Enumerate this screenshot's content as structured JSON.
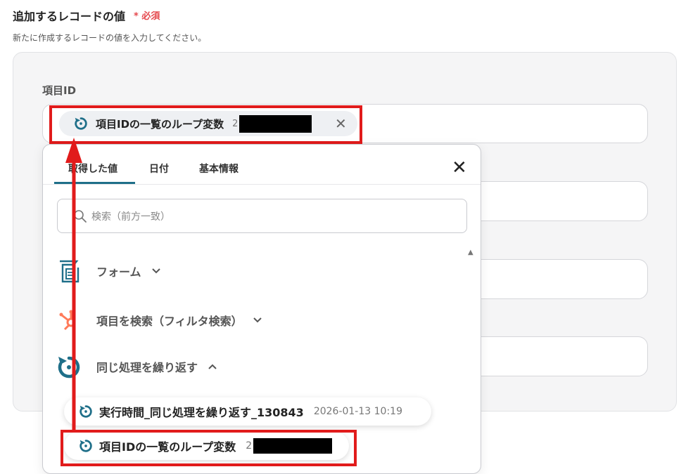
{
  "section": {
    "title": "追加するレコードの値",
    "required_mark": "* 必須",
    "description": "新たに作成するレコードの値を入力してください。"
  },
  "field": {
    "label": "項目ID",
    "chip_label": "項目IDの一覧のループ変数",
    "chip_value_prefix": "2"
  },
  "dropdown": {
    "tabs": [
      {
        "label": "取得した値"
      },
      {
        "label": "日付"
      },
      {
        "label": "基本情報"
      }
    ],
    "search_placeholder": "検索（前方一致）",
    "groups": [
      {
        "label": "フォーム",
        "icon": "form-icon"
      },
      {
        "label": "項目を検索（フィルタ検索）",
        "icon": "hubspot-icon"
      },
      {
        "label": "同じ処理を繰り返す",
        "icon": "loop-icon"
      }
    ],
    "items": [
      {
        "label": "実行時間_同じ処理を繰り返す_130843",
        "value": "2026-01-13 10:19"
      },
      {
        "label": "項目IDの一覧のループ変数",
        "value": "2"
      }
    ]
  },
  "colors": {
    "accent": "#1f6f89",
    "required": "#e5484d",
    "highlight": "#e11b1b",
    "hubspot": "#ff7a59"
  }
}
